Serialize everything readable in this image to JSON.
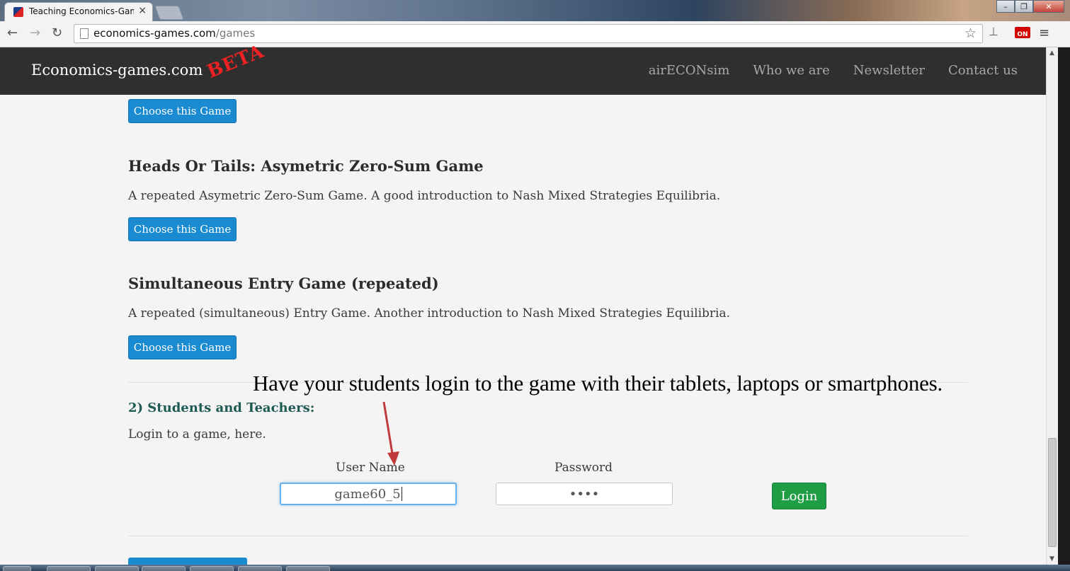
{
  "browser": {
    "tab_title": "Teaching Economics-Gam",
    "tab_close": "×",
    "url_domain": "economics-games.com",
    "url_path": "/games",
    "window_controls": [
      "–",
      "❐",
      "✕"
    ]
  },
  "site": {
    "brand": "Economics-games.com",
    "beta": "BETA",
    "nav": [
      "airECONsim",
      "Who we are",
      "Newsletter",
      "Contact us"
    ]
  },
  "games": [
    {
      "title": "Heads Or Tails: Asymetric Zero-Sum Game",
      "description": "A repeated Asymetric Zero-Sum Game. A good introduction to Nash Mixed Strategies Equilibria."
    },
    {
      "title": "Simultaneous Entry Game (repeated)",
      "description": "A repeated (simultaneous) Entry Game. Another introduction to Nash Mixed Strategies Equilibria."
    }
  ],
  "choose_label": "Choose this Game",
  "login_section": {
    "heading": "2) Students and Teachers:",
    "subtitle": "Login to a game, here.",
    "username_label": "User Name",
    "username_value": "game60_5",
    "password_label": "Password",
    "password_value": "••••",
    "login_button": "Login"
  },
  "annotation": "Have your students login to the game with their tablets, laptops or smartphones.",
  "colors": {
    "navbar": "#2f2f2f",
    "choose_button": "#1a8ad1",
    "login_button": "#1f9d45",
    "section_heading": "#1e5a54",
    "beta": "#ee2222",
    "arrow": "#c0393b"
  }
}
